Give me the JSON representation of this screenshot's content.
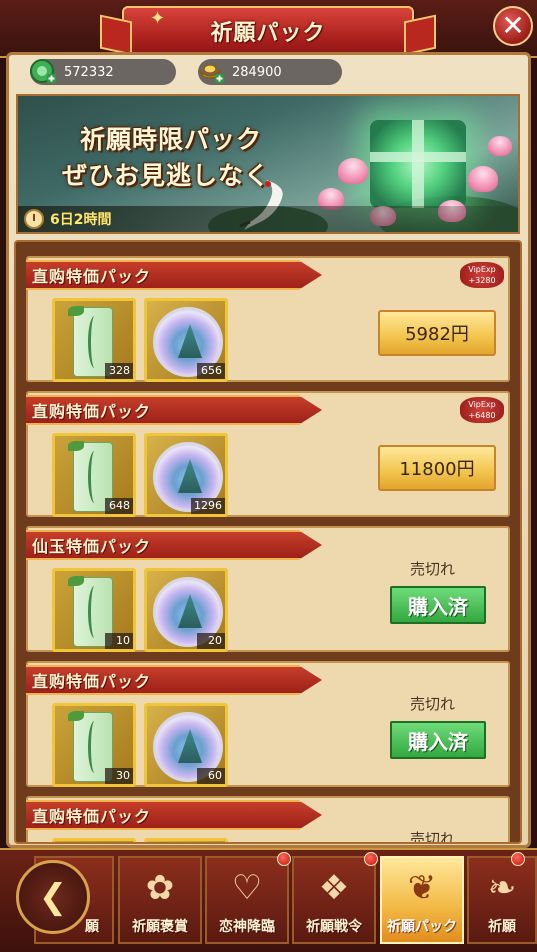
{
  "header": {
    "title": "祈願パック",
    "close_symbol": "✕"
  },
  "currencies": [
    {
      "name": "jade",
      "value": "572332"
    },
    {
      "name": "gold",
      "value": "284900"
    }
  ],
  "banner": {
    "line1": "祈願時限パック",
    "line2": "ぜひお見逃しなく",
    "timer": "6日2時間"
  },
  "packs": [
    {
      "title": "直购特価パック",
      "item1_qty": "328",
      "item2_qty": "656",
      "price": "5982円",
      "vip_line1": "VipExp",
      "vip_line2": "+3280",
      "status": "buy"
    },
    {
      "title": "直购特価パック",
      "item1_qty": "648",
      "item2_qty": "1296",
      "price": "11800円",
      "vip_line1": "VipExp",
      "vip_line2": "+6480",
      "status": "buy"
    },
    {
      "title": "仙玉特価パック",
      "item1_qty": "10",
      "item2_qty": "20",
      "soldout": "売切れ",
      "bought": "購入済",
      "status": "sold"
    },
    {
      "title": "直购特価パック",
      "item1_qty": "30",
      "item2_qty": "60",
      "soldout": "売切れ",
      "bought": "購入済",
      "status": "sold"
    },
    {
      "title": "直购特価パック",
      "soldout": "売切れ",
      "status": "sold"
    }
  ],
  "nav": {
    "tabs": [
      {
        "label": "願",
        "badge": false
      },
      {
        "label": "祈願褒賞",
        "badge": false
      },
      {
        "label": "恋神降臨",
        "badge": true
      },
      {
        "label": "祈願戦令",
        "badge": true
      },
      {
        "label": "祈願パック",
        "badge": false,
        "active": true
      },
      {
        "label": "祈願",
        "badge": true
      }
    ]
  }
}
